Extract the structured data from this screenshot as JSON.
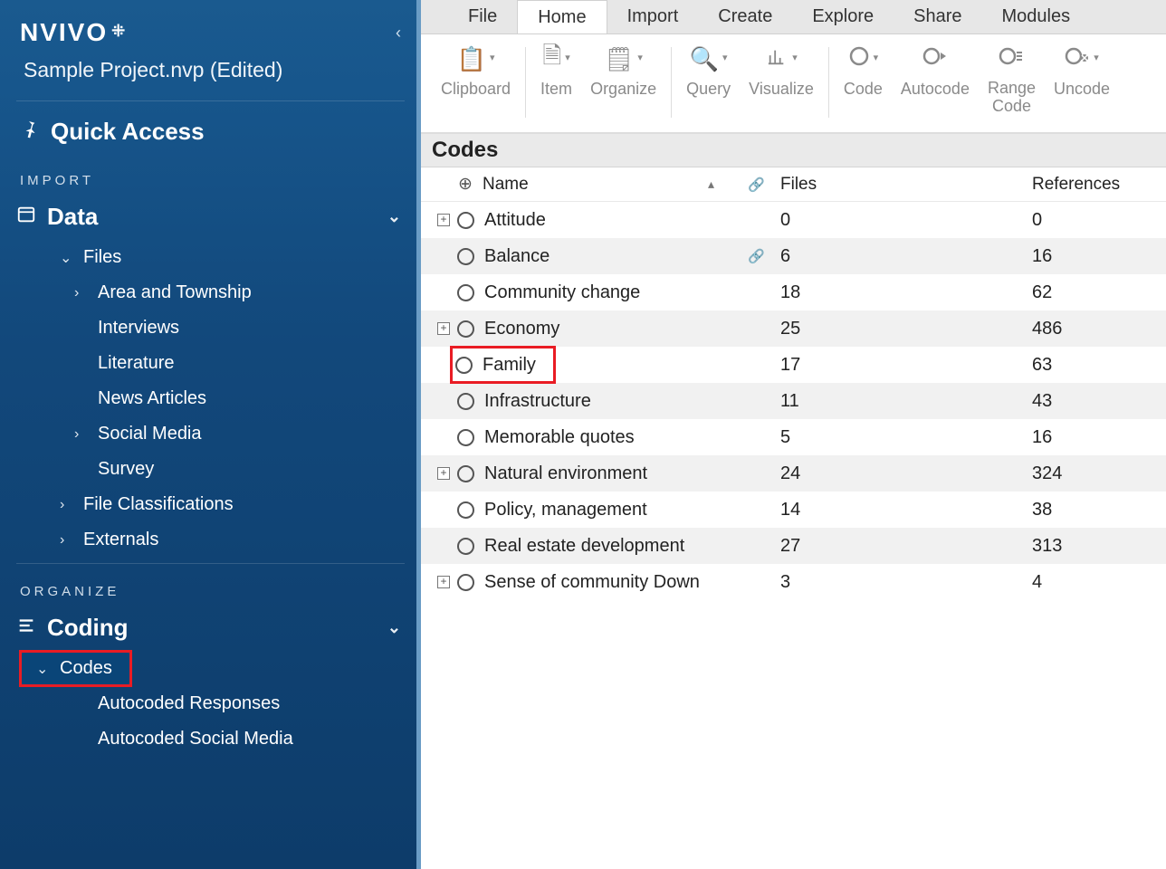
{
  "sidebar": {
    "app_name": "NVIVO",
    "project": "Sample Project.nvp (Edited)",
    "quick_access": "Quick Access",
    "import_label": "IMPORT",
    "data_label": "Data",
    "data_items": {
      "files": "Files",
      "area": "Area and Township",
      "interviews": "Interviews",
      "literature": "Literature",
      "news": "News Articles",
      "social": "Social Media",
      "survey": "Survey",
      "fileclass": "File Classifications",
      "externals": "Externals"
    },
    "organize_label": "ORGANIZE",
    "coding_label": "Coding",
    "coding_items": {
      "codes": "Codes",
      "auto_resp": "Autocoded Responses",
      "auto_social": "Autocoded Social Media"
    }
  },
  "menubar": [
    "File",
    "Home",
    "Import",
    "Create",
    "Explore",
    "Share",
    "Modules"
  ],
  "ribbon": {
    "clipboard": "Clipboard",
    "item": "Item",
    "organize": "Organize",
    "query": "Query",
    "visualize": "Visualize",
    "code": "Code",
    "autocode": "Autocode",
    "rangecode1": "Range",
    "rangecode2": "Code",
    "uncode": "Uncode"
  },
  "panel": {
    "title": "Codes",
    "col_name": "Name",
    "col_files": "Files",
    "col_refs": "References"
  },
  "rows": [
    {
      "name": "Attitude",
      "files": "0",
      "refs": "0",
      "expandable": true,
      "link": false
    },
    {
      "name": "Balance",
      "files": "6",
      "refs": "16",
      "expandable": false,
      "link": true
    },
    {
      "name": "Community change",
      "files": "18",
      "refs": "62",
      "expandable": false,
      "link": false
    },
    {
      "name": "Economy",
      "files": "25",
      "refs": "486",
      "expandable": true,
      "link": false
    },
    {
      "name": "Family",
      "files": "17",
      "refs": "63",
      "expandable": false,
      "link": false,
      "highlight": true
    },
    {
      "name": "Infrastructure",
      "files": "11",
      "refs": "43",
      "expandable": false,
      "link": false
    },
    {
      "name": "Memorable quotes",
      "files": "5",
      "refs": "16",
      "expandable": false,
      "link": false
    },
    {
      "name": "Natural environment",
      "files": "24",
      "refs": "324",
      "expandable": true,
      "link": false
    },
    {
      "name": "Policy, management",
      "files": "14",
      "refs": "38",
      "expandable": false,
      "link": false
    },
    {
      "name": "Real estate development",
      "files": "27",
      "refs": "313",
      "expandable": false,
      "link": false
    },
    {
      "name": "Sense of community Down",
      "files": "3",
      "refs": "4",
      "expandable": true,
      "link": false
    }
  ]
}
